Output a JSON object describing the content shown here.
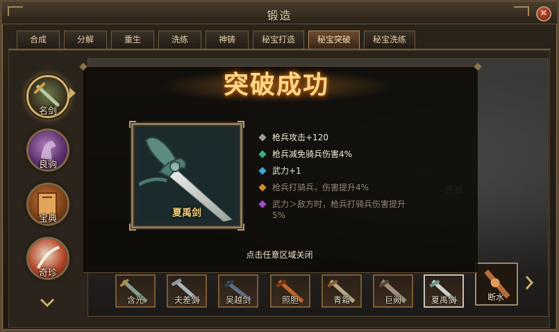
{
  "window": {
    "title": "锻造"
  },
  "tabs": [
    {
      "label": "合成"
    },
    {
      "label": "分解"
    },
    {
      "label": "重生"
    },
    {
      "label": "洗练"
    },
    {
      "label": "神铸"
    },
    {
      "label": "秘宝打造"
    },
    {
      "label": "秘宝突破"
    },
    {
      "label": "秘宝洗练"
    }
  ],
  "active_tab": "秘宝突破",
  "categories": [
    {
      "label": "名剑"
    },
    {
      "label": "良驹"
    },
    {
      "label": "宝典"
    },
    {
      "label": "奇珍"
    }
  ],
  "popup": {
    "title": "突破成功",
    "item_name": "夏禹剑",
    "attributes": [
      {
        "text": "枪兵攻击+120",
        "color": "#9a9a9a",
        "dim": false
      },
      {
        "text": "枪兵减免骑兵伤害4%",
        "color": "#36b37a",
        "dim": false
      },
      {
        "text": "武力+1",
        "color": "#3fa6e0",
        "dim": false
      },
      {
        "text": "枪兵打骑兵，伤害提升4%",
        "color": "#d08a2e",
        "dim": true
      },
      {
        "text": "武力＞敌方时，枪兵打骑兵伤害提升5%",
        "color": "#a24bd0",
        "dim": true
      }
    ],
    "close_hint": "点击任意区域关闭"
  },
  "background_text": "资源",
  "items": [
    {
      "name": "含光"
    },
    {
      "name": "夫差剑"
    },
    {
      "name": "吴越剑"
    },
    {
      "name": "照胆"
    },
    {
      "name": "青霜"
    },
    {
      "name": "巨阙"
    },
    {
      "name": "夏禹剑"
    }
  ],
  "next_item": {
    "name": "断水"
  }
}
